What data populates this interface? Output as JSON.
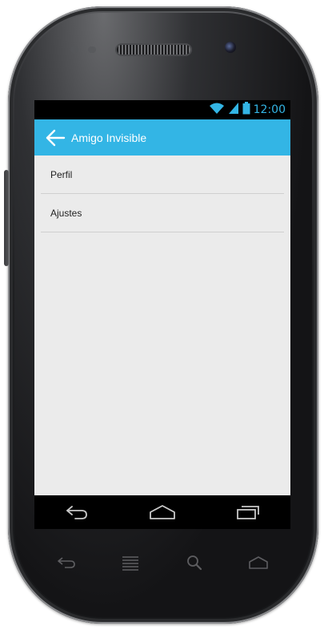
{
  "status_bar": {
    "time": "12:00",
    "icons": [
      "wifi-icon",
      "signal-icon",
      "battery-icon"
    ],
    "accent_color": "#33b5e5"
  },
  "action_bar": {
    "title": "Amigo Invisible",
    "back_icon": "arrow-left-icon",
    "background_color": "#33b5e5"
  },
  "menu": {
    "items": [
      {
        "label": "Perfil"
      },
      {
        "label": "Ajustes"
      }
    ]
  },
  "nav_bar": {
    "buttons": [
      "back-icon",
      "home-icon",
      "recents-icon"
    ]
  },
  "hardware_keys": {
    "buttons": [
      "back-icon",
      "menu-icon",
      "search-icon",
      "home-icon"
    ]
  }
}
